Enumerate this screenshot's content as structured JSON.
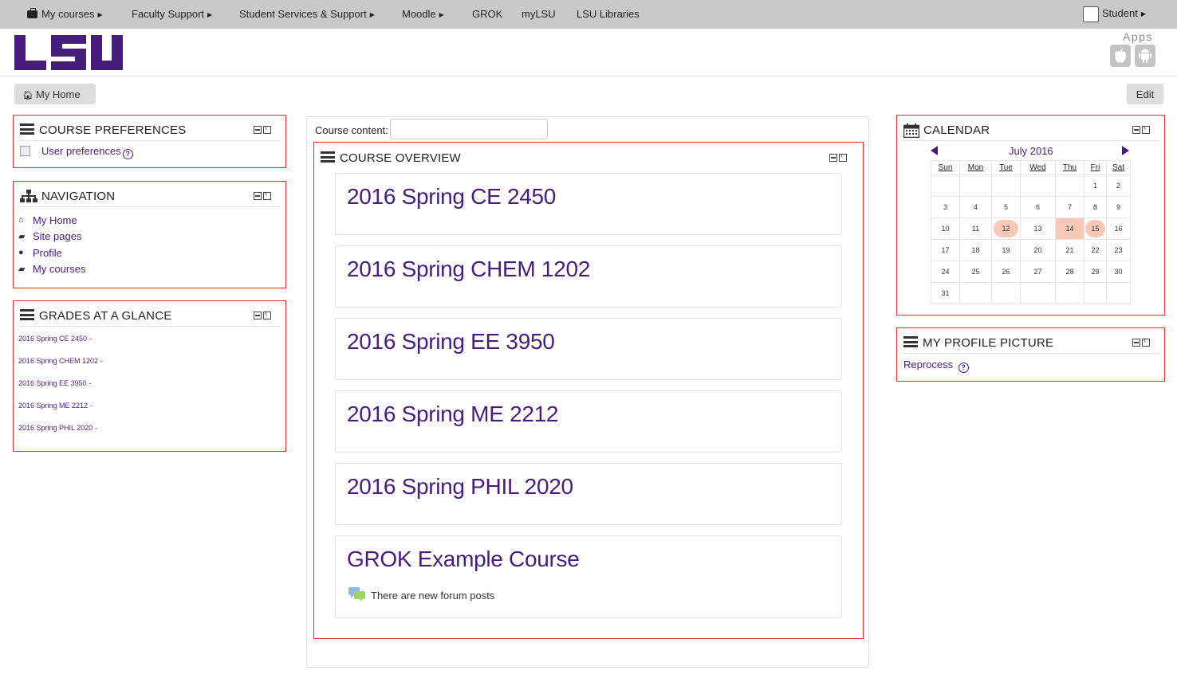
{
  "topnav": {
    "my_courses": "My courses",
    "faculty_support": "Faculty Support",
    "student_services": "Student Services & Support",
    "moodle": "Moodle",
    "grok": "GROK",
    "mylsu": "myLSU",
    "libraries": "LSU Libraries",
    "student": "Student"
  },
  "header": {
    "logo_text": "LSU",
    "apps_label": "Apps",
    "brand_color": "#461d7c"
  },
  "breadcrumb": {
    "home": "My Home",
    "edit": "Edit"
  },
  "course_preferences": {
    "title": "COURSE PREFERENCES",
    "link": "User preferences"
  },
  "navigation": {
    "title": "NAVIGATION",
    "items": [
      {
        "label": "My Home",
        "icon": "home-icon"
      },
      {
        "label": "Site pages",
        "icon": "folder-icon"
      },
      {
        "label": "Profile",
        "icon": "user-icon"
      },
      {
        "label": "My courses",
        "icon": "folder-icon"
      }
    ]
  },
  "grades": {
    "title": "GRADES AT A GLANCE",
    "rows": [
      {
        "course": "2016 Spring CE 2450",
        "grade": "-"
      },
      {
        "course": "2016 Spring CHEM 1202",
        "grade": "-"
      },
      {
        "course": "2016 Spring EE 3950",
        "grade": "-"
      },
      {
        "course": "2016 Spring ME 2212",
        "grade": "-"
      },
      {
        "course": "2016 Spring PHIL 2020",
        "grade": "-"
      }
    ]
  },
  "course_overview": {
    "content_label": "Course content:",
    "search_value": "",
    "title": "COURSE OVERVIEW",
    "courses": [
      {
        "name": "2016 Spring CE 2450"
      },
      {
        "name": "2016 Spring CHEM 1202"
      },
      {
        "name": "2016 Spring EE 3950"
      },
      {
        "name": "2016 Spring ME 2212"
      },
      {
        "name": "2016 Spring PHIL 2020"
      },
      {
        "name": "GROK Example Course",
        "note": "There are new forum posts"
      }
    ]
  },
  "calendar": {
    "title": "CALENDAR",
    "month": "July 2016",
    "weekdays": [
      "Sun",
      "Mon",
      "Tue",
      "Wed",
      "Thu",
      "Fri",
      "Sat"
    ],
    "weeks": [
      [
        "",
        "",
        "",
        "",
        "",
        "1",
        "2"
      ],
      [
        "3",
        "4",
        "5",
        "6",
        "7",
        "8",
        "9"
      ],
      [
        "10",
        "11",
        "12",
        "13",
        "14",
        "15",
        "16"
      ],
      [
        "17",
        "18",
        "19",
        "20",
        "21",
        "22",
        "23"
      ],
      [
        "24",
        "25",
        "26",
        "27",
        "28",
        "29",
        "30"
      ],
      [
        "31",
        "",
        "",
        "",
        "",
        "",
        ""
      ]
    ],
    "highlight_days": [
      "12",
      "15"
    ],
    "today": "14",
    "highlight_color": "#f9c9b8"
  },
  "profile_picture": {
    "title": "MY PROFILE PICTURE",
    "link": "Reprocess"
  }
}
